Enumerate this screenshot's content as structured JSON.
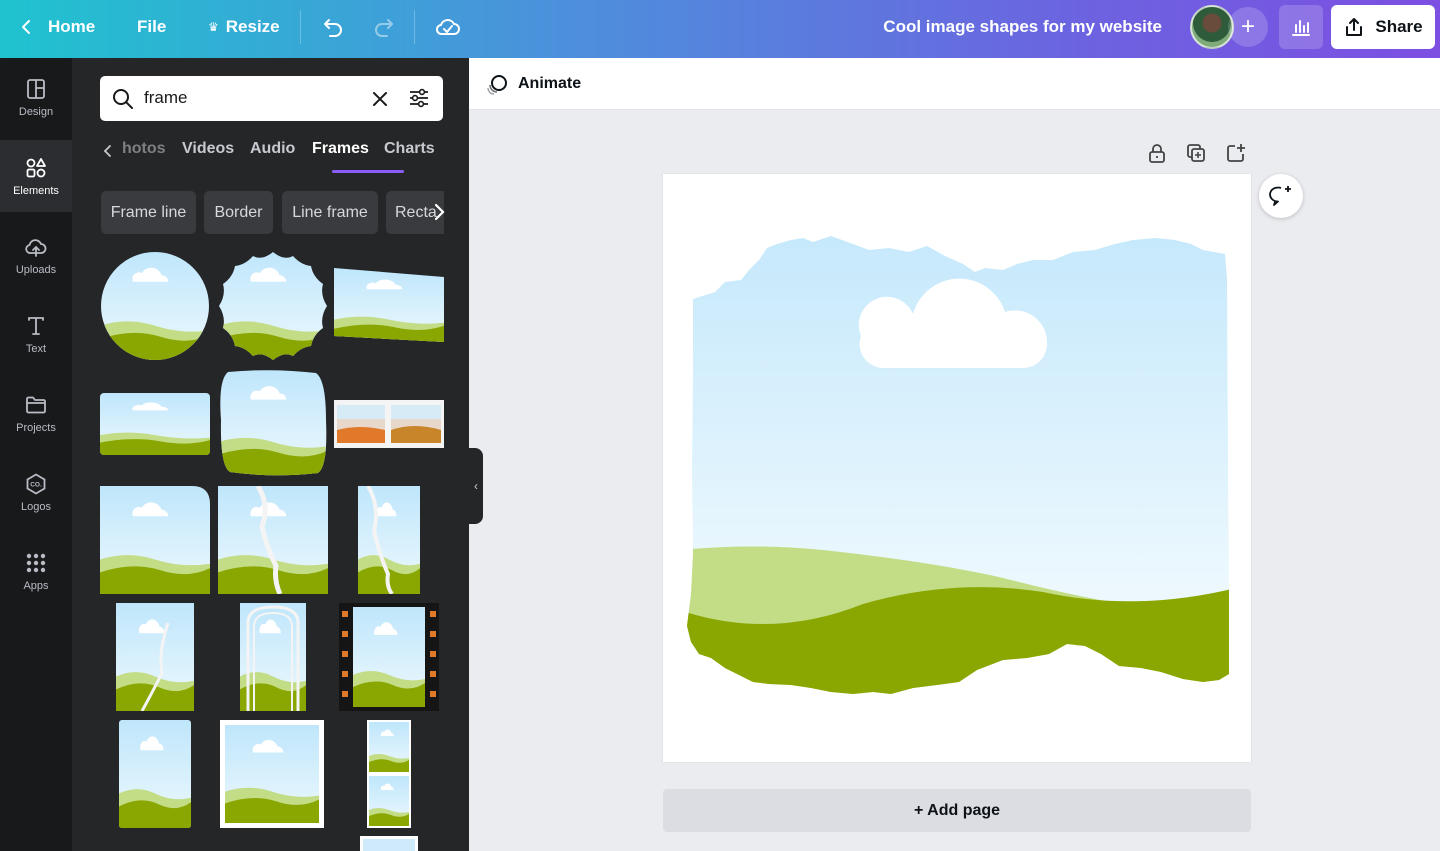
{
  "topbar": {
    "home_label": "Home",
    "file_label": "File",
    "resize_label": "Resize",
    "title": "Cool image shapes for my website",
    "share_label": "Share"
  },
  "rail": {
    "items": [
      {
        "label": "Design",
        "icon": "layout-icon"
      },
      {
        "label": "Elements",
        "icon": "shapes-icon",
        "active": true
      },
      {
        "label": "Uploads",
        "icon": "cloud-upload-icon"
      },
      {
        "label": "Text",
        "icon": "text-icon"
      },
      {
        "label": "Projects",
        "icon": "folder-icon"
      },
      {
        "label": "Logos",
        "icon": "logo-icon"
      },
      {
        "label": "Apps",
        "icon": "grid-dots-icon"
      }
    ]
  },
  "panel": {
    "search_value": "frame",
    "tabs": [
      "hotos",
      "Videos",
      "Audio",
      "Frames",
      "Charts"
    ],
    "active_tab": "Frames",
    "chips": [
      "Frame line",
      "Border",
      "Line frame",
      "Recta"
    ]
  },
  "editor": {
    "animate_label": "Animate",
    "add_page_label": "+ Add page"
  },
  "colors": {
    "sky_top": "#bfe6fb",
    "sky_bottom": "#eaf7fd",
    "hill_light": "#c3dc86",
    "hill_dark": "#89a700",
    "accent": "#8b5cf6"
  }
}
